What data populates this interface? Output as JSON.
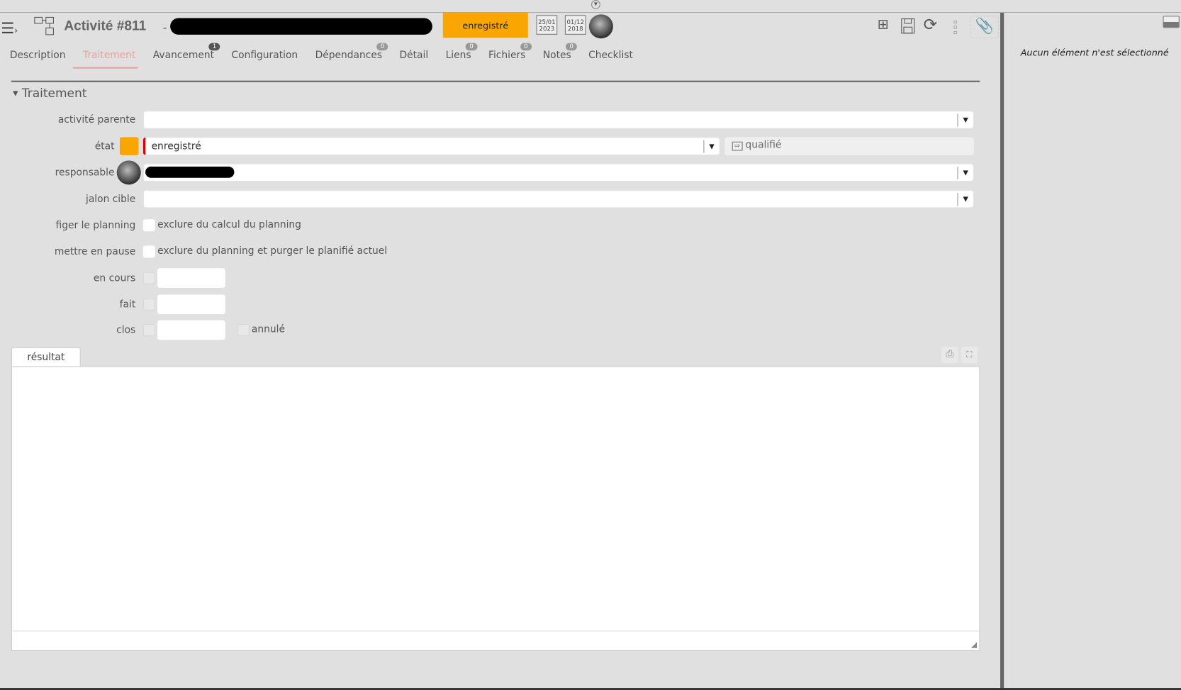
{
  "header": {
    "title": "Activité  #811",
    "separator": "-",
    "status": "enregistré",
    "dates": [
      {
        "day": "25/01",
        "year": "2023"
      },
      {
        "day": "01/12",
        "year": "2018"
      }
    ]
  },
  "tabs": [
    {
      "label": "Description"
    },
    {
      "label": "Traitement",
      "active": true
    },
    {
      "label": "Avancement",
      "badge": "1"
    },
    {
      "label": "Configuration"
    },
    {
      "label": "Dépendances",
      "badge": "0"
    },
    {
      "label": "Détail"
    },
    {
      "label": "Liens",
      "badge": "0"
    },
    {
      "label": "Fichiers",
      "badge": "0"
    },
    {
      "label": "Notes",
      "badge": "0"
    },
    {
      "label": "Checklist"
    }
  ],
  "section": {
    "title": "Traitement"
  },
  "form": {
    "parent_label": "activité parente",
    "state_label": "état",
    "state_value": "enregistré",
    "state_color": "#f9a602",
    "next_state": "qualifié",
    "owner_label": "responsable",
    "milestone_label": "jalon cible",
    "freeze_label": "figer le planning",
    "freeze_text": "exclure du calcul du planning",
    "pause_label": "mettre en pause",
    "pause_text": "exclure du planning et purger le planifié actuel",
    "inprogress_label": "en cours",
    "done_label": "fait",
    "closed_label": "clos",
    "cancelled_label": "annulé"
  },
  "result": {
    "tab_label": "résultat"
  },
  "right_panel": {
    "empty_text": "Aucun élément n'est sélectionné"
  }
}
